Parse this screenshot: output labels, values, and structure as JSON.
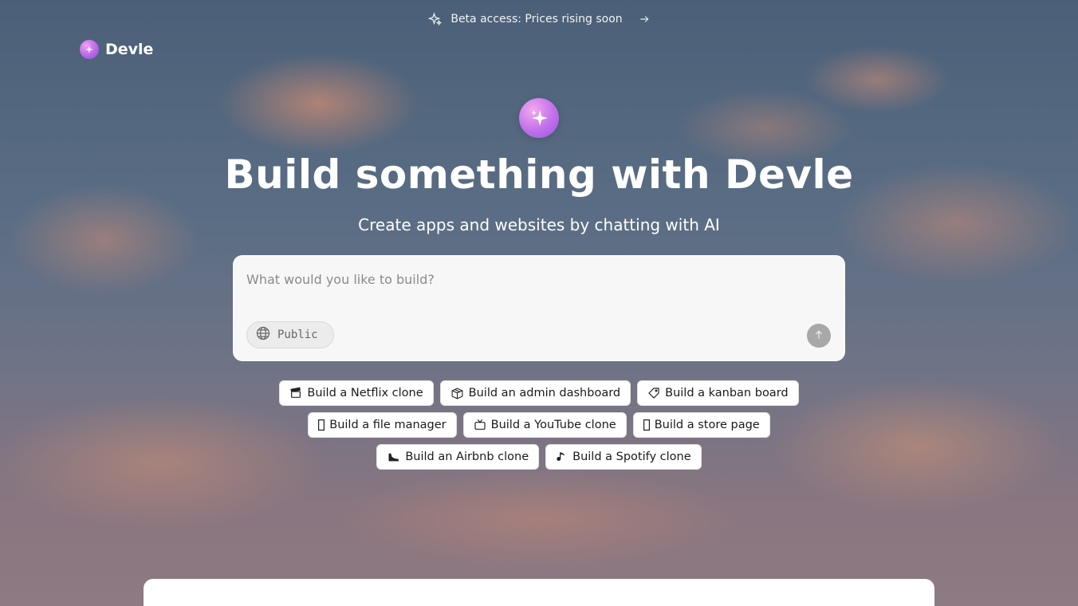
{
  "banner": {
    "text": "Beta access: Prices rising soon",
    "icon": "sparkle-outline-icon",
    "arrow_icon": "arrow-right-icon"
  },
  "brand": {
    "name": "Devle",
    "logo_icon": "sparkle-logo-icon"
  },
  "hero": {
    "logo_icon": "sparkle-logo-icon",
    "title": "Build something with Devle",
    "subtitle": "Create apps and websites by chatting with AI"
  },
  "prompt": {
    "placeholder": "What would you like to build?",
    "value": "",
    "visibility_label": "Public",
    "visibility_icon": "globe-icon",
    "send_icon": "arrow-up-icon"
  },
  "suggestions": {
    "row1": [
      {
        "label": "Build a Netflix clone",
        "icon": "clapperboard-icon"
      },
      {
        "label": "Build an admin dashboard",
        "icon": "package-icon"
      },
      {
        "label": "Build a kanban board",
        "icon": "tag-icon"
      }
    ],
    "row2": [
      {
        "label": "Build a file manager",
        "icon": "folder-icon"
      },
      {
        "label": "Build a YouTube clone",
        "icon": "tv-icon"
      },
      {
        "label": "Build a store page",
        "icon": "shopping-bag-icon"
      }
    ],
    "row3": [
      {
        "label": "Build an Airbnb clone",
        "icon": "shoe-icon"
      },
      {
        "label": "Build a Spotify clone",
        "icon": "music-note-icon"
      }
    ]
  },
  "colors": {
    "accent_purple": "#b968e8",
    "send_button": "#a8a8a8",
    "chip_background": "#ffffff"
  }
}
